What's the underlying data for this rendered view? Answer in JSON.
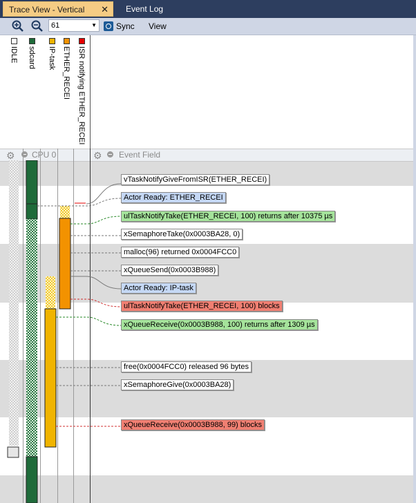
{
  "tabs": [
    {
      "label": "Trace View - Vertical",
      "active": true,
      "close": "✕"
    },
    {
      "label": "Event Log",
      "active": false
    }
  ],
  "toolbar": {
    "zoom_in_icon": "zoom-in-icon",
    "zoom_out_icon": "zoom-out-icon",
    "zoom_value": "61",
    "sync_label": "Sync",
    "view_label": "View"
  },
  "actors": [
    {
      "name": "IDLE",
      "color": "#ffffff"
    },
    {
      "name": "sdcard",
      "color": "#1f6b3a"
    },
    {
      "name": "IP-task",
      "color": "#f0b400"
    },
    {
      "name": "ETHER_RECEI",
      "color": "#f39200"
    },
    {
      "name": "ISR notifying ETHER_RECEI",
      "color": "#e60000"
    }
  ],
  "fields": {
    "cpu_label": "CPU 0",
    "event_label": "Event Field"
  },
  "events": [
    {
      "text": "vTaskNotifyGiveFromISR(ETHER_RECEI)",
      "kind": "plain"
    },
    {
      "text": "Actor Ready: ETHER_RECEI",
      "kind": "blue"
    },
    {
      "text": "ulTaskNotifyTake(ETHER_RECEI, 100) returns after 10375 µs",
      "kind": "green"
    },
    {
      "text": "xSemaphoreTake(0x0003BA28, 0)",
      "kind": "plain"
    },
    {
      "text": "malloc(96) returned 0x0004FCC0",
      "kind": "plain"
    },
    {
      "text": "xQueueSend(0x0003B988)",
      "kind": "plain"
    },
    {
      "text": "Actor Ready: IP-task",
      "kind": "blue"
    },
    {
      "text": "ulTaskNotifyTake(ETHER_RECEI, 100) blocks",
      "kind": "red"
    },
    {
      "text": "xQueueReceive(0x0003B988, 100) returns after 1309 µs",
      "kind": "green"
    },
    {
      "text": "free(0x0004FCC0) released 96 bytes",
      "kind": "plain"
    },
    {
      "text": "xSemaphoreGive(0x0003BA28)",
      "kind": "plain"
    },
    {
      "text": "xQueueReceive(0x0003B988, 99) blocks",
      "kind": "red"
    }
  ],
  "colors": {
    "event_plain": "#ffffff",
    "event_blue": "#c5d8f5",
    "event_green": "#a5e39b",
    "event_red": "#f07f72"
  }
}
